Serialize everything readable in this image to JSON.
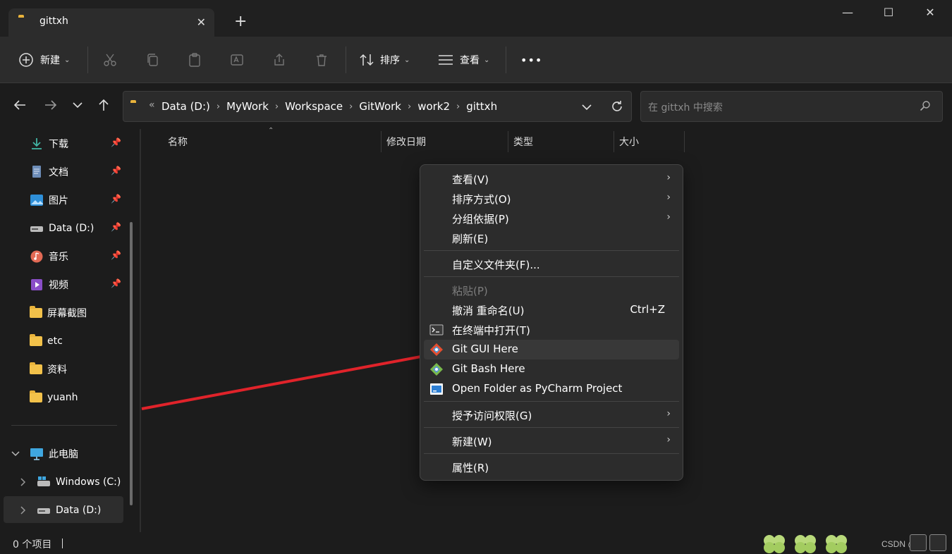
{
  "window": {
    "tab_title": "gittxh",
    "tab_close": "✕",
    "new_tab": "+",
    "minimize": "—",
    "maximize": "☐",
    "close": "✕"
  },
  "toolbar": {
    "new_label": "新建",
    "sort_label": "排序",
    "view_label": "查看",
    "more_label": "•••"
  },
  "address": {
    "overflow": "«",
    "crumbs": [
      "Data (D:)",
      "MyWork",
      "Workspace",
      "GitWork",
      "work2",
      "gittxh"
    ],
    "search_placeholder": "在 gittxh 中搜索"
  },
  "sidebar": {
    "quick": [
      {
        "label": "下载",
        "icon": "download-icon"
      },
      {
        "label": "文档",
        "icon": "document-icon"
      },
      {
        "label": "图片",
        "icon": "pictures-icon"
      },
      {
        "label": "Data (D:)",
        "icon": "drive-icon"
      },
      {
        "label": "音乐",
        "icon": "music-icon"
      },
      {
        "label": "视频",
        "icon": "video-icon"
      },
      {
        "label": "屏幕截图",
        "icon": "folder-icon"
      },
      {
        "label": "etc",
        "icon": "folder-icon"
      },
      {
        "label": "资料",
        "icon": "folder-icon"
      },
      {
        "label": "yuanh",
        "icon": "folder-icon"
      }
    ],
    "this_pc": "此电脑",
    "drives": [
      "Windows (C:)",
      "Data (D:)"
    ]
  },
  "columns": [
    "名称",
    "修改日期",
    "类型",
    "大小"
  ],
  "status": {
    "items": "0 个项目",
    "watermark": "CSDN @亦"
  },
  "context_menu": {
    "view": "查看(V)",
    "sort": "排序方式(O)",
    "group": "分组依据(P)",
    "refresh": "刷新(E)",
    "customize": "自定义文件夹(F)...",
    "paste": "粘贴(P)",
    "undo": "撤消 重命名(U)",
    "undo_shortcut": "Ctrl+Z",
    "terminal": "在终端中打开(T)",
    "git_gui": "Git GUI Here",
    "git_bash": "Git Bash Here",
    "pycharm": "Open Folder as PyCharm Project",
    "access": "授予访问权限(G)",
    "new": "新建(W)",
    "properties": "属性(R)"
  },
  "colors": {
    "background": "#1c1c1c",
    "menu": "#2c2c2c",
    "folder": "#f2c14a",
    "arrow": "#e0232a"
  }
}
